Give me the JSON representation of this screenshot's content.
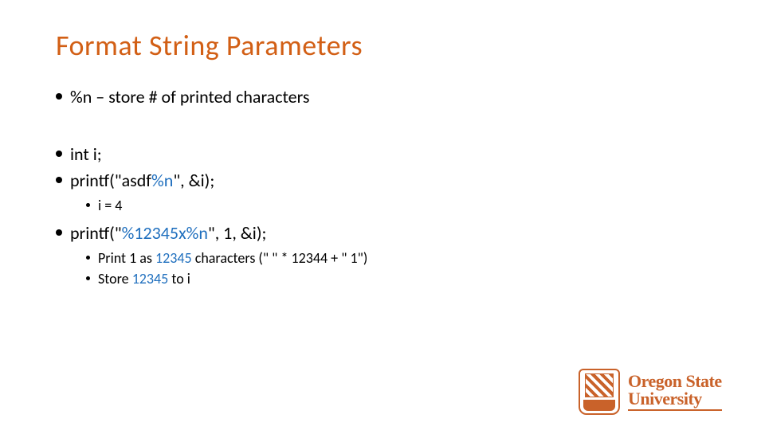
{
  "title": "Format String Parameters",
  "bullets": {
    "b1_text": "%n – store # of printed characters",
    "b2_text": "int i;",
    "b3_pre": "printf(\"asdf",
    "b3_fmt": "%n",
    "b3_post": "\", &i);",
    "b3a_text": "i = 4",
    "b4_pre": "printf(\"",
    "b4_fmt": "%12345x%n",
    "b4_post": "\", 1, &i);",
    "b4a_pre": "Print 1 as ",
    "b4a_num": "12345",
    "b4a_post": " characters (\" \" * 12344 + \" 1\")",
    "b4b_pre": "Store ",
    "b4b_num": "12345",
    "b4b_post": " to i"
  },
  "logo": {
    "line1": "Oregon State",
    "line2": "University"
  },
  "colors": {
    "title": "#D25F15",
    "accent": "#1F6FBE",
    "brand": "#C9622A"
  }
}
